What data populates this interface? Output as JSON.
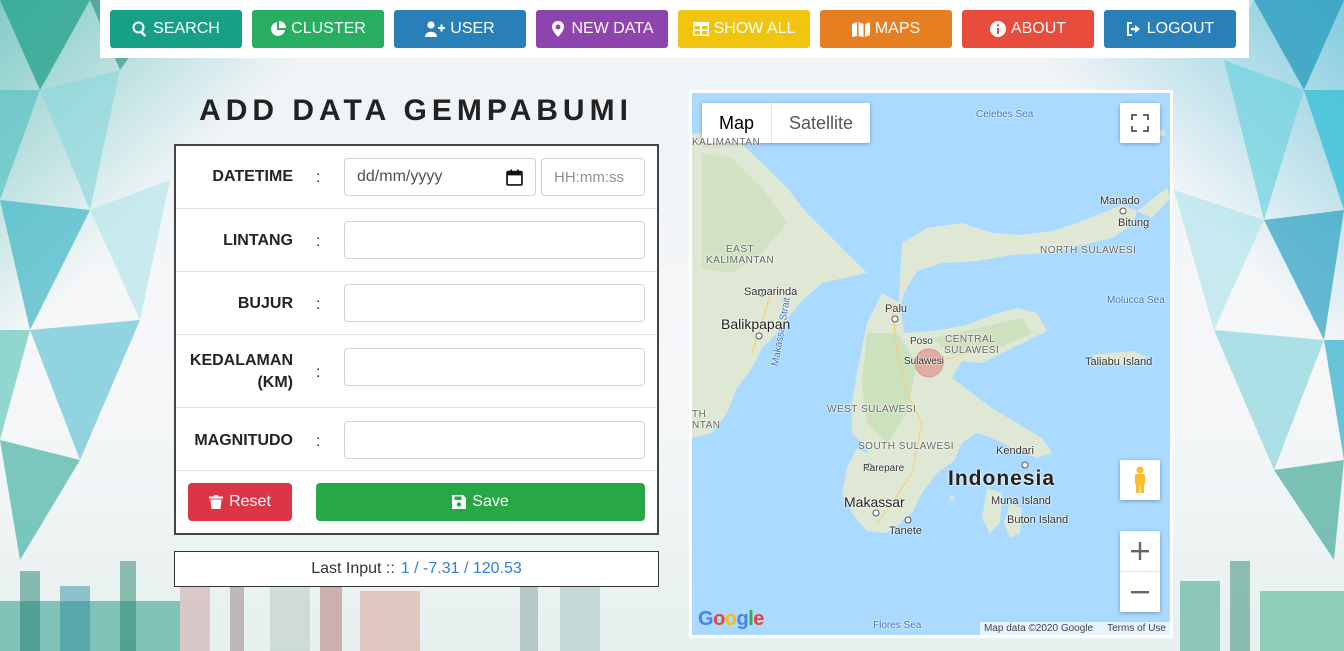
{
  "nav": {
    "items": [
      {
        "label": "SEARCH",
        "color": "#16a085",
        "icon": "search-icon"
      },
      {
        "label": "CLUSTER",
        "color": "#27ae60",
        "icon": "pie-chart-icon"
      },
      {
        "label": "USER",
        "color": "#2980b9",
        "icon": "user-plus-icon"
      },
      {
        "label": "NEW DATA",
        "color": "#8e44ad",
        "icon": "map-marker-icon"
      },
      {
        "label": "SHOW ALL",
        "color": "#f1c40f",
        "icon": "table-icon"
      },
      {
        "label": "MAPS",
        "color": "#e67e22",
        "icon": "map-icon"
      },
      {
        "label": "ABOUT",
        "color": "#e74c3c",
        "icon": "info-icon"
      },
      {
        "label": "LOGOUT",
        "color": "#2980b9",
        "icon": "sign-out-icon"
      }
    ]
  },
  "page": {
    "title": "ADD DATA GEMPABUMI"
  },
  "form": {
    "colon": ":",
    "datetime": {
      "label": "DATETIME",
      "date_value": "dd/mm/yyyy",
      "time_placeholder": "HH:mm:ss"
    },
    "lintang": {
      "label": "LINTANG",
      "value": ""
    },
    "bujur": {
      "label": "BUJUR",
      "value": ""
    },
    "kedalaman": {
      "label_line1": "KEDALAMAN",
      "label_line2": "(KM)",
      "value": ""
    },
    "magnitudo": {
      "label": "MAGNITUDO",
      "value": ""
    },
    "reset_label": "Reset",
    "save_label": "Save"
  },
  "last_input": {
    "label": "Last Input ::",
    "value": "1 / -7.31 / 120.53"
  },
  "map": {
    "type_map": "Map",
    "type_satellite": "Satellite",
    "attribution": "Map data ©2020 Google",
    "terms": "Terms of Use",
    "logo": "Google",
    "labels": {
      "celebes_sea": "Celebes Sea",
      "molucca_sea": "Molucca Sea",
      "makassar_strait": "Makassar Strait",
      "flores_sea": "Flores Sea",
      "kalimantan": "KALIMANTAN",
      "east_kalimantan_1": "EAST",
      "east_kalimantan_2": "KALIMANTAN",
      "north_sulawesi": "NORTH SULAWESI",
      "central_sulawesi_1": "CENTRAL",
      "central_sulawesi_2": "SULAWESI",
      "west_sulawesi": "WEST SULAWESI",
      "south_sulawesi": "SOUTH SULAWESI",
      "than": "TH",
      "ntan": "NTAN",
      "manado": "Manado",
      "bitung": "Bitung",
      "samarinda": "Samarinda",
      "balikpapan": "Balikpapan",
      "palu": "Palu",
      "poso": "Poso",
      "sulawesi": "Sulawesi",
      "taliabu": "Taliabu Island",
      "kendari": "Kendari",
      "indonesia": "Indonesia",
      "parepare": "Parepare",
      "makassar": "Makassar",
      "muna": "Muna Island",
      "buton": "Buton Island",
      "tanete": "Tanete"
    }
  }
}
